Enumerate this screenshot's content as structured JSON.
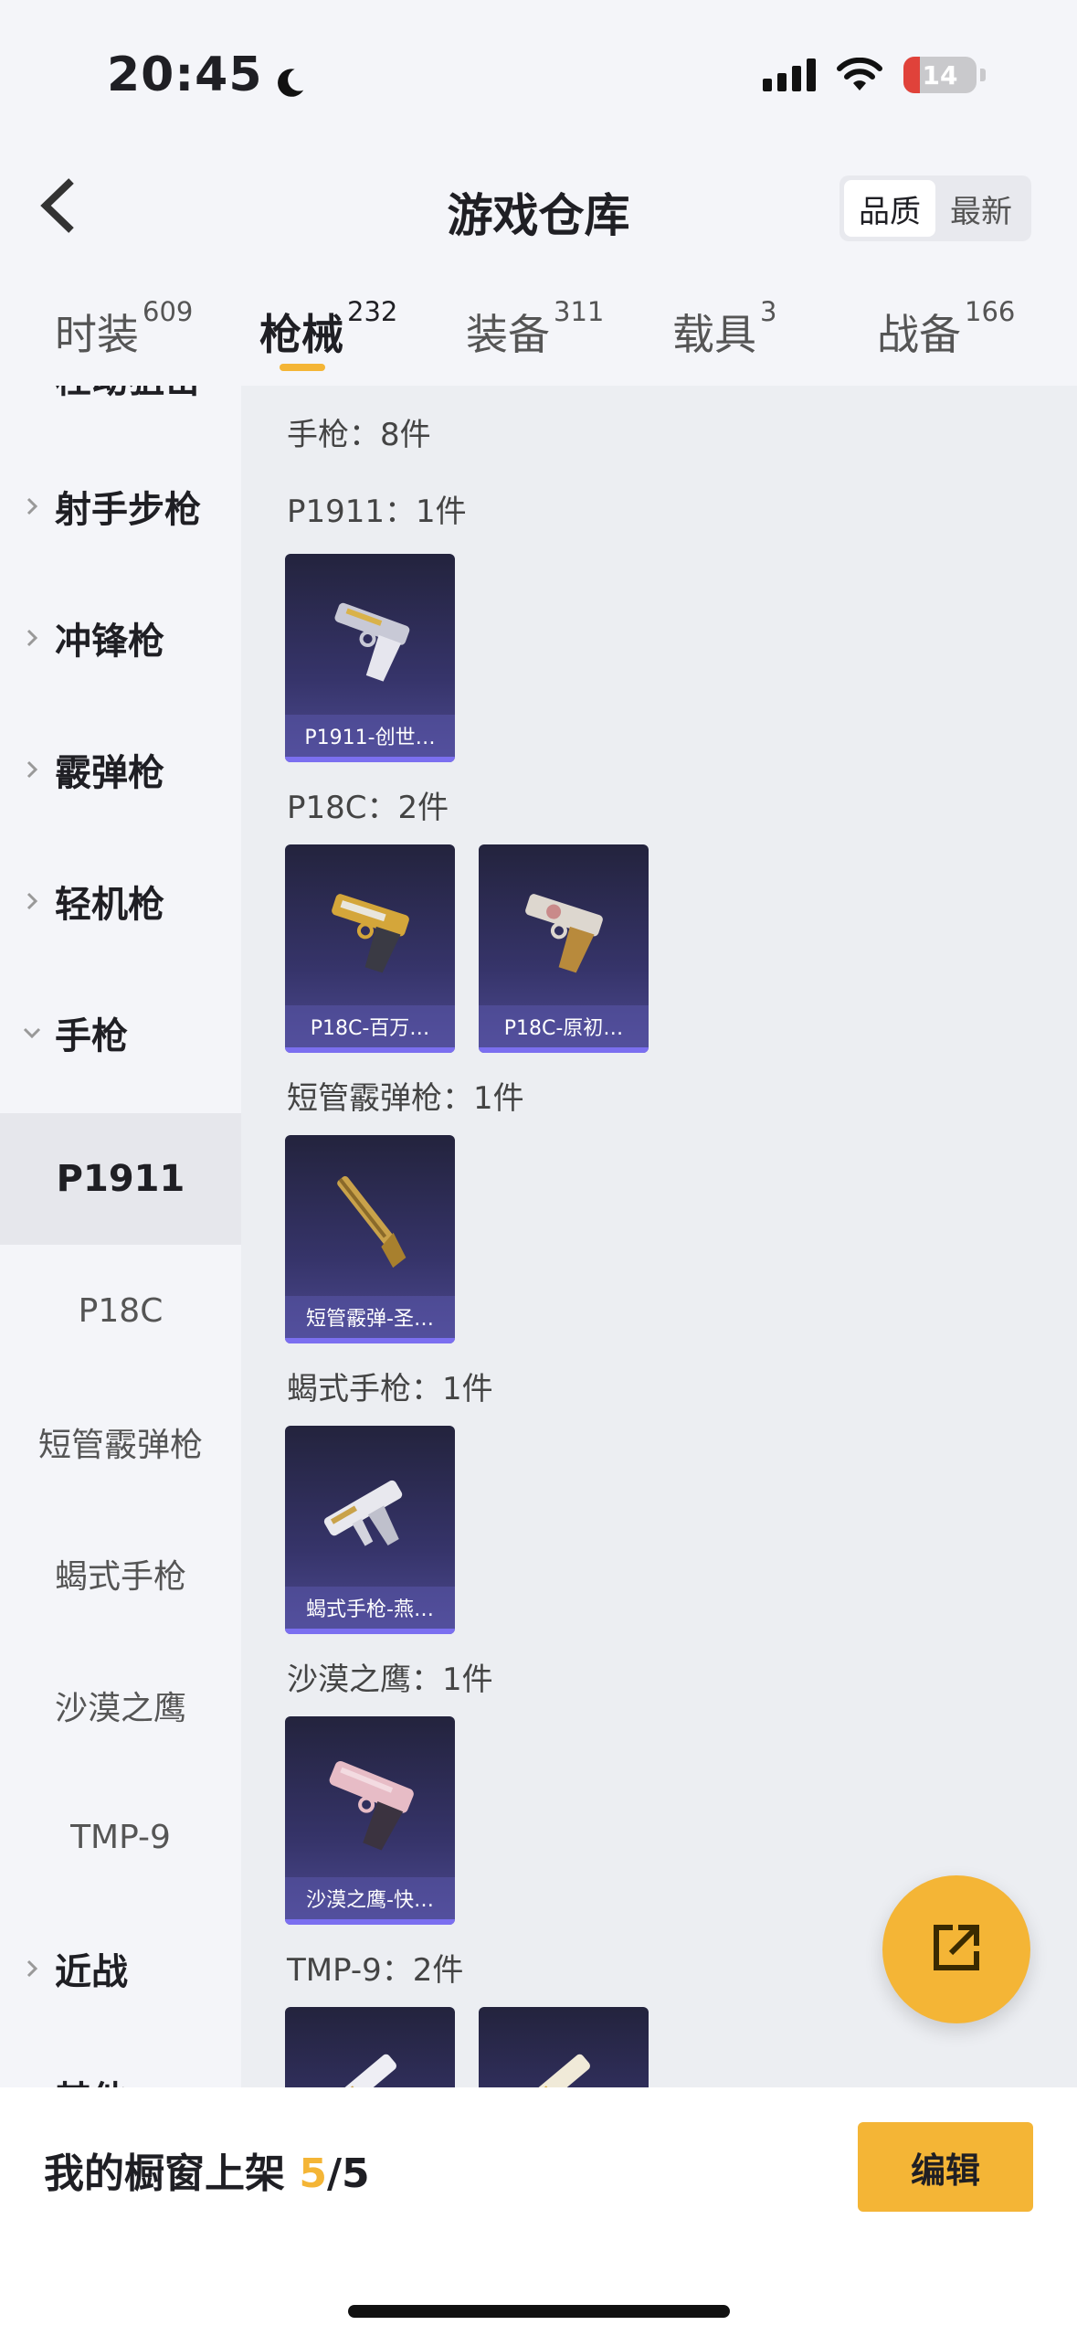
{
  "status_bar": {
    "time": "20:45",
    "battery": "14"
  },
  "header": {
    "title": "游戏仓库",
    "sort_options": [
      "品质",
      "最新"
    ],
    "active_sort": "品质"
  },
  "tabs": [
    {
      "label": "时装",
      "count": "609"
    },
    {
      "label": "枪械",
      "count": "232"
    },
    {
      "label": "装备",
      "count": "311"
    },
    {
      "label": "载具",
      "count": "3"
    },
    {
      "label": "战备",
      "count": "166"
    }
  ],
  "active_tab": "枪械",
  "sidebar": {
    "partial_top": "栓动狙击",
    "categories": [
      "射手步枪",
      "冲锋枪",
      "霰弹枪",
      "轻机枪",
      "手枪"
    ],
    "expanded": "手枪",
    "subitems": [
      "P1911",
      "P18C",
      "短管霰弹枪",
      "蝎式手枪",
      "沙漠之鹰",
      "TMP-9"
    ],
    "active_sub": "P1911",
    "after": "近战",
    "partial_bottom": "其他"
  },
  "main": {
    "section_title": "手枪：8件",
    "groups": [
      {
        "title": "P1911：1件",
        "items": [
          "P1911-创世…"
        ]
      },
      {
        "title": "P18C：2件",
        "items": [
          "P18C-百万…",
          "P18C-原初…"
        ]
      },
      {
        "title": "短管霰弹枪：1件",
        "items": [
          "短管霰弹-圣…"
        ]
      },
      {
        "title": "蝎式手枪：1件",
        "items": [
          "蝎式手枪-燕…"
        ]
      },
      {
        "title": "沙漠之鹰：1件",
        "items": [
          "沙漠之鹰-快…"
        ]
      },
      {
        "title": "TMP-9：2件",
        "items": [
          "",
          ""
        ]
      }
    ]
  },
  "bottom": {
    "label": "我的橱窗上架 ",
    "current": "5",
    "total": "/5",
    "edit_label": "编辑"
  },
  "colors": {
    "accent": "#f4b536",
    "card_bg": "#36346a",
    "card_bar": "#7b6ff0"
  },
  "icons": [
    "moon-icon",
    "signal-icon",
    "wifi-icon",
    "battery-icon",
    "back-icon",
    "chevron-right-icon",
    "chevron-down-icon",
    "share-icon"
  ]
}
